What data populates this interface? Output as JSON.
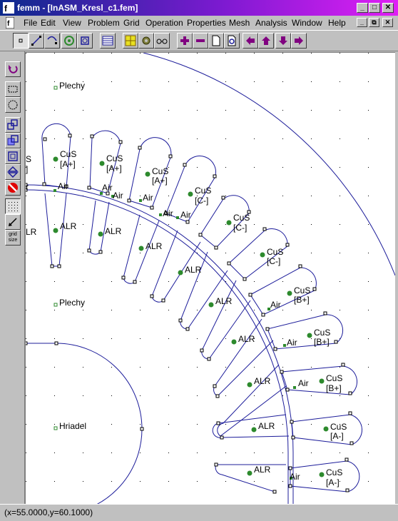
{
  "window": {
    "title": "femm - [InASM_Kresl_c1.fem]"
  },
  "menu": [
    "File",
    "Edit",
    "View",
    "Problem",
    "Grid",
    "Operation",
    "Properties",
    "Mesh",
    "Analysis",
    "Window",
    "Help"
  ],
  "sidebar": {
    "grid_size_line1": "grid",
    "grid_size_line2": "size"
  },
  "canvas": {
    "labels": {
      "plechy_top": "Plechy",
      "plechy_mid": "Plechy",
      "hriadel": "Hriadel",
      "left_s": "S",
      "left_bracket": "]",
      "left_r": "r",
      "left_lr": "LR"
    },
    "rotor_labels": [
      {
        "air": "Air",
        "alr": "ALR"
      },
      {
        "air": "Air",
        "alr": "ALR"
      },
      {
        "air": "Air",
        "alr": "ALR"
      },
      {
        "air": "Air",
        "alr": "ALR"
      },
      {
        "air": "Air",
        "alr": "ALR"
      },
      {
        "air": "Air",
        "alr": "ALR"
      },
      {
        "air": "Air",
        "alr": "ALR"
      },
      {
        "air": "Air",
        "alr": "ALR"
      },
      {
        "air": "Air",
        "alr": "ALR"
      },
      {
        "air": "Air",
        "alr": "ALR"
      }
    ],
    "stator_labels": [
      {
        "cu": "CuS",
        "phase": "[A+]"
      },
      {
        "cu": "CuS",
        "phase": "[A+]"
      },
      {
        "cu": "CuS",
        "phase": "[A+]"
      },
      {
        "cu": "CuS",
        "phase": "[C-]"
      },
      {
        "cu": "CuS",
        "phase": "[C-]"
      },
      {
        "cu": "CuS",
        "phase": "[C-]"
      },
      {
        "cu": "CuS",
        "phase": "[B+]"
      },
      {
        "cu": "CuS",
        "phase": "[B+]"
      },
      {
        "cu": "CuS",
        "phase": "[B+]"
      },
      {
        "cu": "CuS",
        "phase": "[A-]"
      },
      {
        "cu": "CuS",
        "phase": "[A-]"
      }
    ]
  },
  "status": {
    "coords": "(x=55.0000,y=60.1000)"
  },
  "colors": {
    "geometry": "#1c1c9a",
    "label_dot": "#2d8a2d",
    "node": "#000000"
  }
}
